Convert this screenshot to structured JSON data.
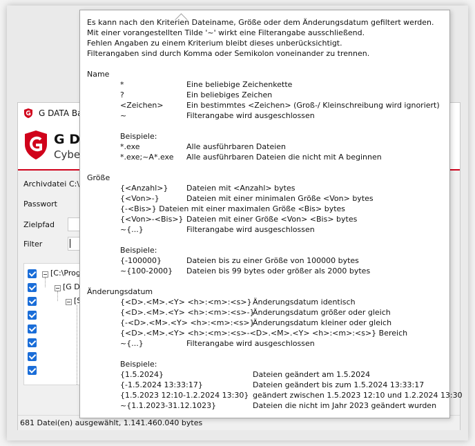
{
  "app": {
    "window_title": "G DATA Bac",
    "brand": "G DA",
    "brand_sub": "Cyber",
    "archive_label": "Archivdatei",
    "archive_value": "C:\\",
    "password_label": "Passwort",
    "target_label": "Zielpfad",
    "filter_label": "Filter",
    "tree": [
      {
        "label": "[C:\\Prog"
      },
      {
        "label": "[G DA"
      },
      {
        "label": "[S"
      }
    ],
    "status": "681 Datei(en) ausgewählt, 1.141.460.040 bytes"
  },
  "tooltip": {
    "intro": [
      "Es kann nach den Kriterien Dateiname, Größe oder dem Änderungsdatum gefiltert werden.",
      "Mit einer vorangestellten Tilde '~' wirkt eine Filterangabe ausschließend.",
      "Fehlen Angaben zu einem Kriterium bleibt dieses unberücksichtigt.",
      "Filterangaben sind durch Komma oder Semikolon voneinander zu trennen."
    ],
    "name": {
      "heading": "Name",
      "rules": [
        {
          "pattern": "*",
          "desc": "Eine beliebige Zeichenkette"
        },
        {
          "pattern": "?",
          "desc": "Ein beliebiges Zeichen"
        },
        {
          "pattern": "<Zeichen>",
          "desc": "Ein bestimmtes <Zeichen> (Groß-/ Kleinschreibung wird ignoriert)"
        },
        {
          "pattern": "~",
          "desc": "Filterangabe wird ausgeschlossen"
        }
      ],
      "examples_label": "Beispiele:",
      "examples": [
        {
          "pattern": "*.exe",
          "desc": "Alle ausführbaren Dateien"
        },
        {
          "pattern": "*.exe;~A*.exe",
          "desc": "Alle ausführbaren Dateien die nicht mit A beginnen"
        }
      ]
    },
    "size": {
      "heading": "Größe",
      "rules": [
        {
          "pattern": "{<Anzahl>}",
          "desc": "Dateien mit <Anzahl> bytes"
        },
        {
          "pattern": "{<Von>-}",
          "desc": "Dateien mit einer minimalen Größe <Von> bytes"
        },
        {
          "pattern": "{-<Bis>} Dateien mit einer maximalen Größe <Bis> bytes",
          "desc": ""
        },
        {
          "pattern": "{<Von>-<Bis>}",
          "desc": "Dateien mit einer Größe <Von> <Bis> bytes"
        },
        {
          "pattern": "~{...}",
          "desc": "Filterangabe wird ausgeschlossen"
        }
      ],
      "examples_label": "Beispiele:",
      "examples": [
        {
          "pattern": "{-100000}",
          "desc": "Dateien bis zu einer Größe von 100000 bytes"
        },
        {
          "pattern": "~{100-2000}",
          "desc": "Dateien bis 99 bytes oder größer als 2000 bytes"
        }
      ]
    },
    "date": {
      "heading": "Änderungsdatum",
      "rules": [
        {
          "pattern": "{<D>.<M>.<Y> <h>:<m>:<s>}",
          "desc": "Änderungsdatum identisch"
        },
        {
          "pattern": "{<D>.<M>.<Y> <h>:<m>:<s>-}",
          "desc": "Änderungsdatum größer oder gleich"
        },
        {
          "pattern": "{-<D>.<M>.<Y> <h>:<m>:<s>}",
          "desc": "Änderungsdatum kleiner oder gleich"
        },
        {
          "pattern": "{<D>.<M>.<Y> <h>:<m>:<s>-<D>.<M>.<Y> <h>:<m>:<s>} Bereich",
          "desc": ""
        },
        {
          "pattern": "~{...}",
          "desc": "Filterangabe wird ausgeschlossen"
        }
      ],
      "examples_label": "Beispiele:",
      "examples": [
        {
          "pattern": "{1.5.2024}",
          "desc": "Dateien geändert am 1.5.2024"
        },
        {
          "pattern": "{-1.5.2024 13:33:17}",
          "desc": "Dateien geändert bis zum 1.5.2024 13:33:17"
        },
        {
          "pattern": "{1.5.2023 12:10-1.2.2024 13:30}",
          "desc": "geändert zwischen 1.5.2023 12:10 und 1.2.2024 13:30"
        },
        {
          "pattern": "~{1.1.2023-31.12.1023}",
          "desc": "Dateien die nicht im Jahr 2023 geändert wurden"
        }
      ]
    }
  }
}
